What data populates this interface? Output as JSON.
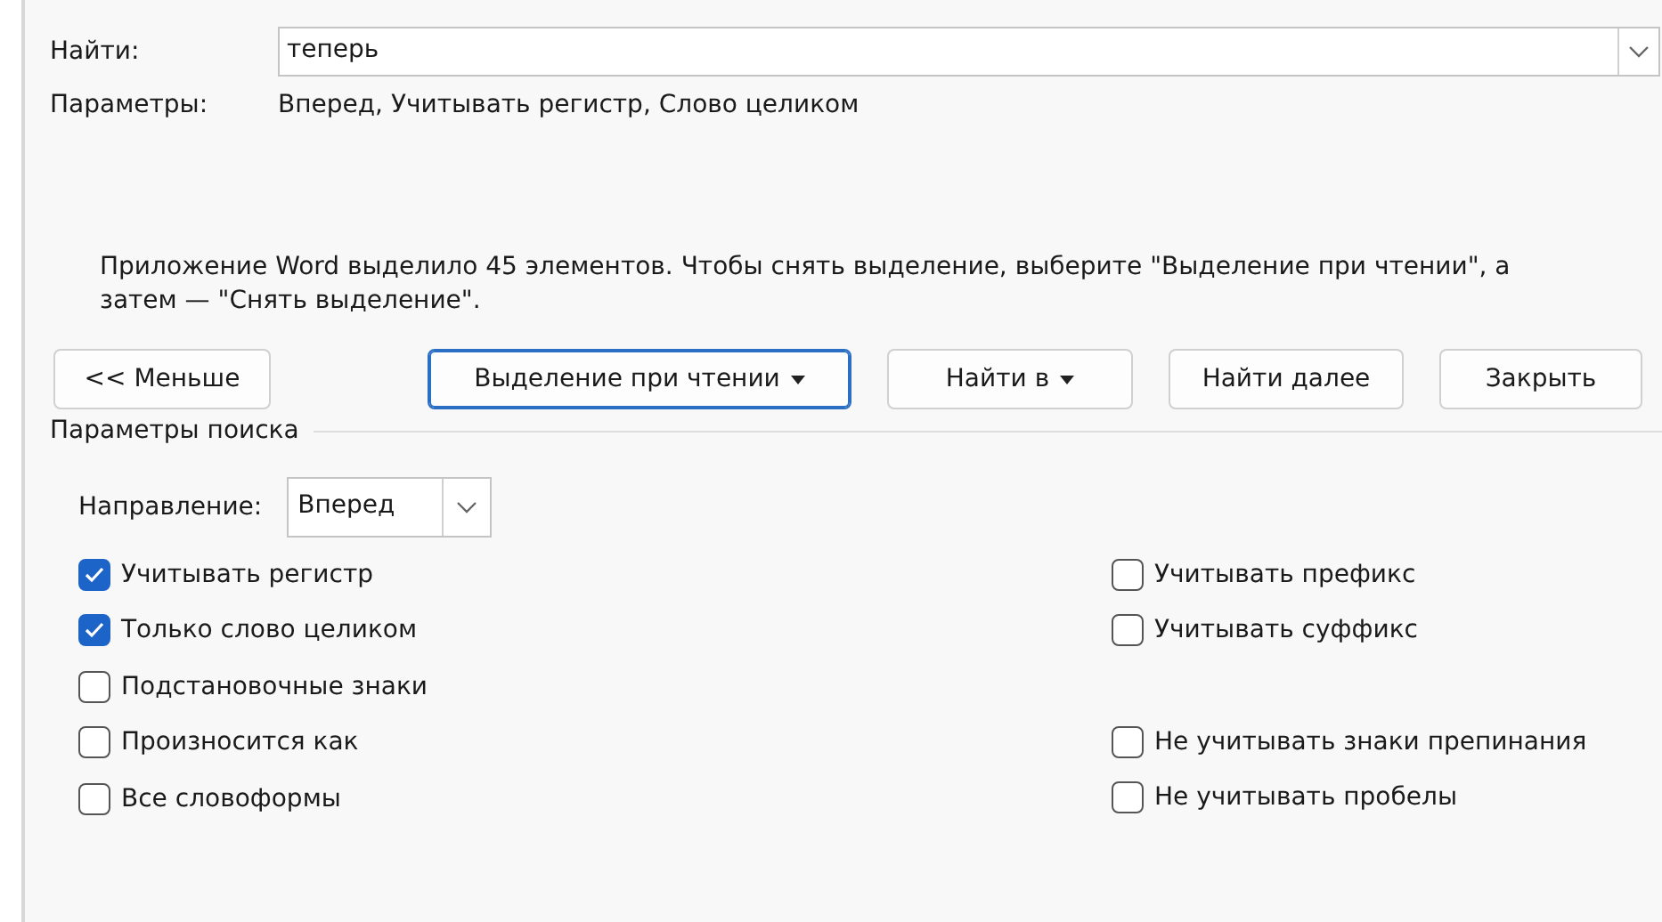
{
  "find": {
    "label": "Найти:",
    "value": "теперь"
  },
  "options_summary": {
    "label": "Параметры:",
    "value": "Вперед, Учитывать регистр, Слово целиком"
  },
  "message": "Приложение Word выделило 45 элементов. Чтобы снять выделение, выберите \"Выделение при чтении\", а затем — \"Снять выделение\".",
  "buttons": [
    {
      "label": "<< Меньше",
      "kind": "plain",
      "focused": false
    },
    {
      "label": "Выделение при чтении",
      "kind": "dropdown",
      "focused": true
    },
    {
      "label": "Найти в",
      "kind": "dropdown",
      "focused": false
    },
    {
      "label": "Найти далее",
      "kind": "plain",
      "focused": false
    },
    {
      "label": "Закрыть",
      "kind": "plain",
      "focused": false
    }
  ],
  "search_options": {
    "title": "Параметры поиска",
    "direction": {
      "label": "Направление:",
      "value": "Вперед"
    },
    "left_options": [
      {
        "label": "Учитывать регистр",
        "checked": true
      },
      {
        "label": "Только слово целиком",
        "checked": true
      },
      {
        "label": "Подстановочные знаки",
        "checked": false
      },
      {
        "label": "Произносится как",
        "checked": false
      },
      {
        "label": "Все словоформы",
        "checked": false
      }
    ],
    "right_groups": [
      [
        {
          "label": "Учитывать префикс",
          "checked": false
        },
        {
          "label": "Учитывать суффикс",
          "checked": false
        }
      ],
      [
        {
          "label": "Не учитывать знаки препинания",
          "checked": false
        },
        {
          "label": "Не учитывать пробелы",
          "checked": false
        }
      ]
    ]
  }
}
